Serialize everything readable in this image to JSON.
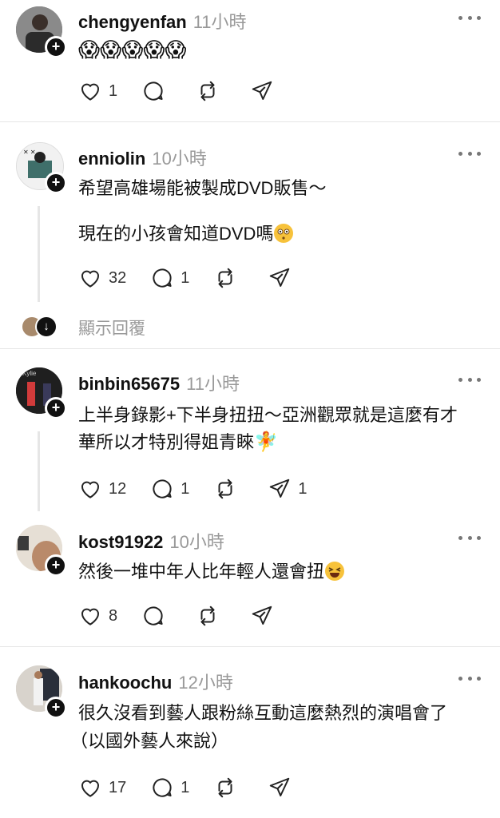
{
  "posts": [
    {
      "username": "chengyenfan",
      "time": "11小時",
      "lines": [
        ""
      ],
      "likes": "1",
      "replies": "",
      "reposts": "",
      "shares": ""
    },
    {
      "username": "enniolin",
      "time": "10小時",
      "lines": [
        "希望高雄場能被製成DVD販售～",
        "現在的小孩會知道DVD嗎"
      ],
      "likes": "32",
      "replies": "1",
      "reposts": "",
      "shares": "",
      "show_replies": "顯示回覆"
    },
    {
      "username": "binbin65675",
      "time": "11小時",
      "lines": [
        "上半身錄影+下半身扭扭～亞洲觀眾就是這麼有才",
        "華所以才特別得姐青睞"
      ],
      "likes": "12",
      "replies": "1",
      "reposts": "",
      "shares": "1"
    },
    {
      "username": "kost91922",
      "time": "10小時",
      "lines": [
        "然後一堆中年人比年輕人還會扭"
      ],
      "likes": "8",
      "replies": "",
      "reposts": "",
      "shares": ""
    },
    {
      "username": "hankoochu",
      "time": "12小時",
      "lines": [
        "很久沒看到藝人跟粉絲互動這麼熱烈的演唱會了",
        "（以國外藝人來說）"
      ],
      "likes": "17",
      "replies": "1",
      "reposts": "",
      "shares": ""
    }
  ],
  "icons": {
    "like": "heart-icon",
    "reply": "comment-icon",
    "repost": "repost-icon",
    "share": "send-icon",
    "more": "more-icon",
    "follow": "plus-icon"
  },
  "colors": {
    "text": "#111111",
    "muted": "#999999",
    "divider": "#e6e6e6"
  }
}
